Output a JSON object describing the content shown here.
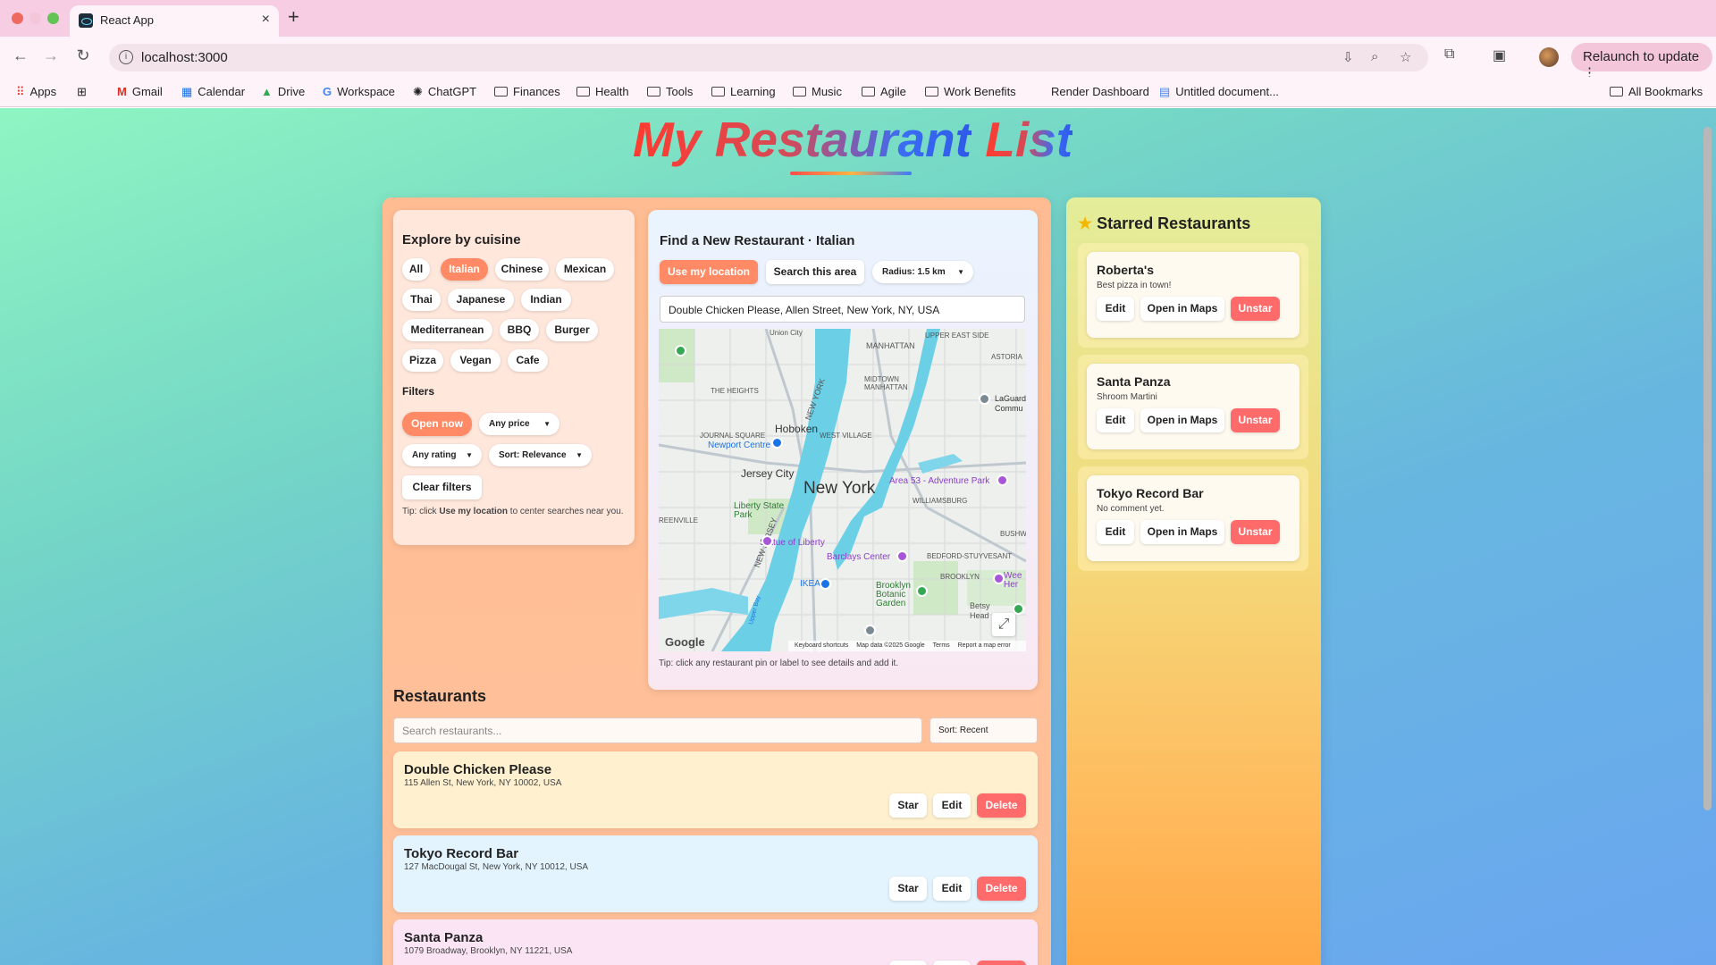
{
  "browser": {
    "tab_title": "React App",
    "url": "localhost:3000",
    "relaunch_label": "Relaunch to update",
    "bookmarks": [
      "Apps",
      "Gmail",
      "Calendar",
      "Drive",
      "Workspace",
      "ChatGPT",
      "Finances",
      "Health",
      "Tools",
      "Learning",
      "Music",
      "Agile",
      "Work Benefits",
      "Render Dashboard",
      "Untitled document..."
    ],
    "all_bookmarks": "All Bookmarks"
  },
  "page": {
    "title_part1": "My Restaurant",
    "title_part2": "List"
  },
  "explore": {
    "heading": "Explore by cuisine",
    "cuisines": [
      "All",
      "Italian",
      "Chinese",
      "Mexican",
      "Thai",
      "Japanese",
      "Indian",
      "Mediterranean",
      "BBQ",
      "Burger",
      "Pizza",
      "Vegan",
      "Cafe"
    ],
    "active_cuisine": "Italian",
    "filters_heading": "Filters",
    "open_now": "Open now",
    "price": "Any price",
    "rating": "Any rating",
    "sort": "Sort: Relevance",
    "clear": "Clear filters",
    "tip_prefix": "Tip: click",
    "tip_bold": "Use my location",
    "tip_suffix": "to center searches near you."
  },
  "finder": {
    "heading": "Find a New Restaurant · Italian",
    "use_location": "Use my location",
    "search_area": "Search this area",
    "radius": "Radius: 1.5 km",
    "address_value": "Double Chicken Please, Allen Street, New York, NY, USA",
    "tip": "Tip: click any restaurant pin or label to see details and add it.",
    "map": {
      "labels": {
        "union_city": "Union City",
        "manhattan": "MANHATTAN",
        "upper_east_side": "UPPER EAST SIDE",
        "astoria": "ASTORIA",
        "the_heights": "THE HEIGHTS",
        "midtown": "MIDTOWN MANHATTAN",
        "laguardia": "LaGuard Commu",
        "hoboken": "Hoboken",
        "journal_square": "JOURNAL SQUARE",
        "west_village": "WEST VILLAGE",
        "newport": "Newport Centre",
        "jersey_city": "Jersey City",
        "new_york": "New York",
        "area53": "Area 53 - Adventure Park",
        "williamsburg": "WILLIAMSBURG",
        "liberty_park": "Liberty State Park",
        "greenville": "REENVILLE",
        "statue": "Statue of Liberty",
        "barclays": "Barclays Center",
        "bushwick": "BUSHWI",
        "bedford": "BEDFORD-STUYVESANT",
        "brooklyn": "BROOKLYN",
        "ikea": "IKEA",
        "botanic": "Brooklyn Botanic Garden",
        "new_jersey": "NEW JERSEY",
        "new_york_river": "NEW YORK",
        "betsy_head": "Betsy Head",
        "wee_her": "Wee Her",
        "upper_bay": "Upper Bay"
      },
      "logo": "Google",
      "footer": [
        "Keyboard shortcuts",
        "Map data ©2025 Google",
        "Terms",
        "Report a map error"
      ]
    }
  },
  "restaurants": {
    "heading": "Restaurants",
    "search_placeholder": "Search restaurants...",
    "sort": "Sort: Recent",
    "star_label": "Star",
    "edit_label": "Edit",
    "delete_label": "Delete",
    "items": [
      {
        "name": "Double Chicken Please",
        "address": "115 Allen St, New York, NY 10002, USA",
        "bg": "#fff1cf"
      },
      {
        "name": "Tokyo Record Bar",
        "address": "127 MacDougal St, New York, NY 10012, USA",
        "bg": "#e3f4ff"
      },
      {
        "name": "Santa Panza",
        "address": "1079 Broadway, Brooklyn, NY 11221, USA",
        "bg": "#fbe5f5"
      }
    ]
  },
  "starred": {
    "heading": "Starred Restaurants",
    "edit_label": "Edit",
    "maps_label": "Open in Maps",
    "unstar_label": "Unstar",
    "items": [
      {
        "name": "Roberta's",
        "note": "Best pizza in town!"
      },
      {
        "name": "Santa Panza",
        "note": "Shroom Martini"
      },
      {
        "name": "Tokyo Record Bar",
        "note": "No comment yet."
      }
    ]
  },
  "colors": {
    "accent_orange": "#ff8a65",
    "danger": "#ff6b6b"
  }
}
